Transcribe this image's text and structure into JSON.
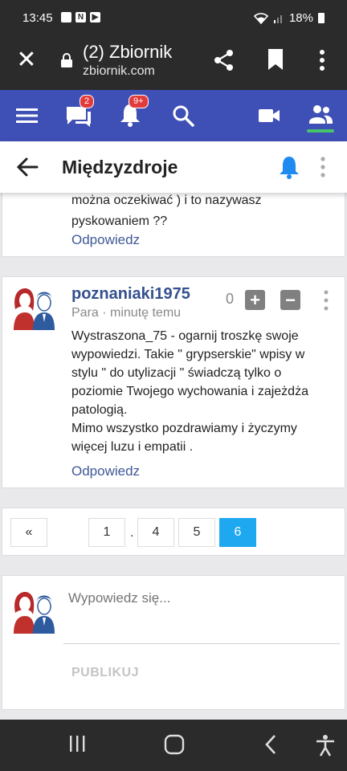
{
  "status_bar": {
    "time": "13:45",
    "battery": "18%",
    "notification_icons": [
      "image-icon",
      "n-icon",
      "youtube-icon"
    ]
  },
  "browser": {
    "title": "(2) Zbiornik",
    "url": "zbiornik.com"
  },
  "nav": {
    "messages_badge": "2",
    "notifications_badge": "9+",
    "badge_color": "#e23b3b",
    "bar_color": "#3e4fb5"
  },
  "page": {
    "title": "Międzyzdroje"
  },
  "previous_comment": {
    "text_lines": [
      "można oczekiwać ) i to nazywasz",
      "pyskowaniem ??"
    ],
    "reply_label": "Odpowiedz"
  },
  "comment": {
    "username": "poznaniaki1975",
    "meta": "Para · minutę temu",
    "score": "0",
    "upvote_label": "+",
    "downvote_label": "−",
    "body_lines": [
      "Wystraszona_75 - ogarnij troszkę swoje",
      "wypowiedzi. Takie \" grypserskie\" wpisy w",
      "stylu \" do utylizacji \" świadczą tylko o",
      "poziomie Twojego wychowania i zajeżdża",
      "patologią.",
      "Mimo wszystko pozdrawiamy i życzymy",
      "więcej luzu i empatii ."
    ],
    "reply_label": "Odpowiedz"
  },
  "pagination": {
    "prev": "«",
    "first": "1",
    "ellipsis": ".",
    "pages": [
      "4",
      "5"
    ],
    "current": "6",
    "active_color": "#1ea8f0"
  },
  "compose": {
    "placeholder": "Wypowiedz się...",
    "publish_label": "PUBLIKUJ"
  }
}
